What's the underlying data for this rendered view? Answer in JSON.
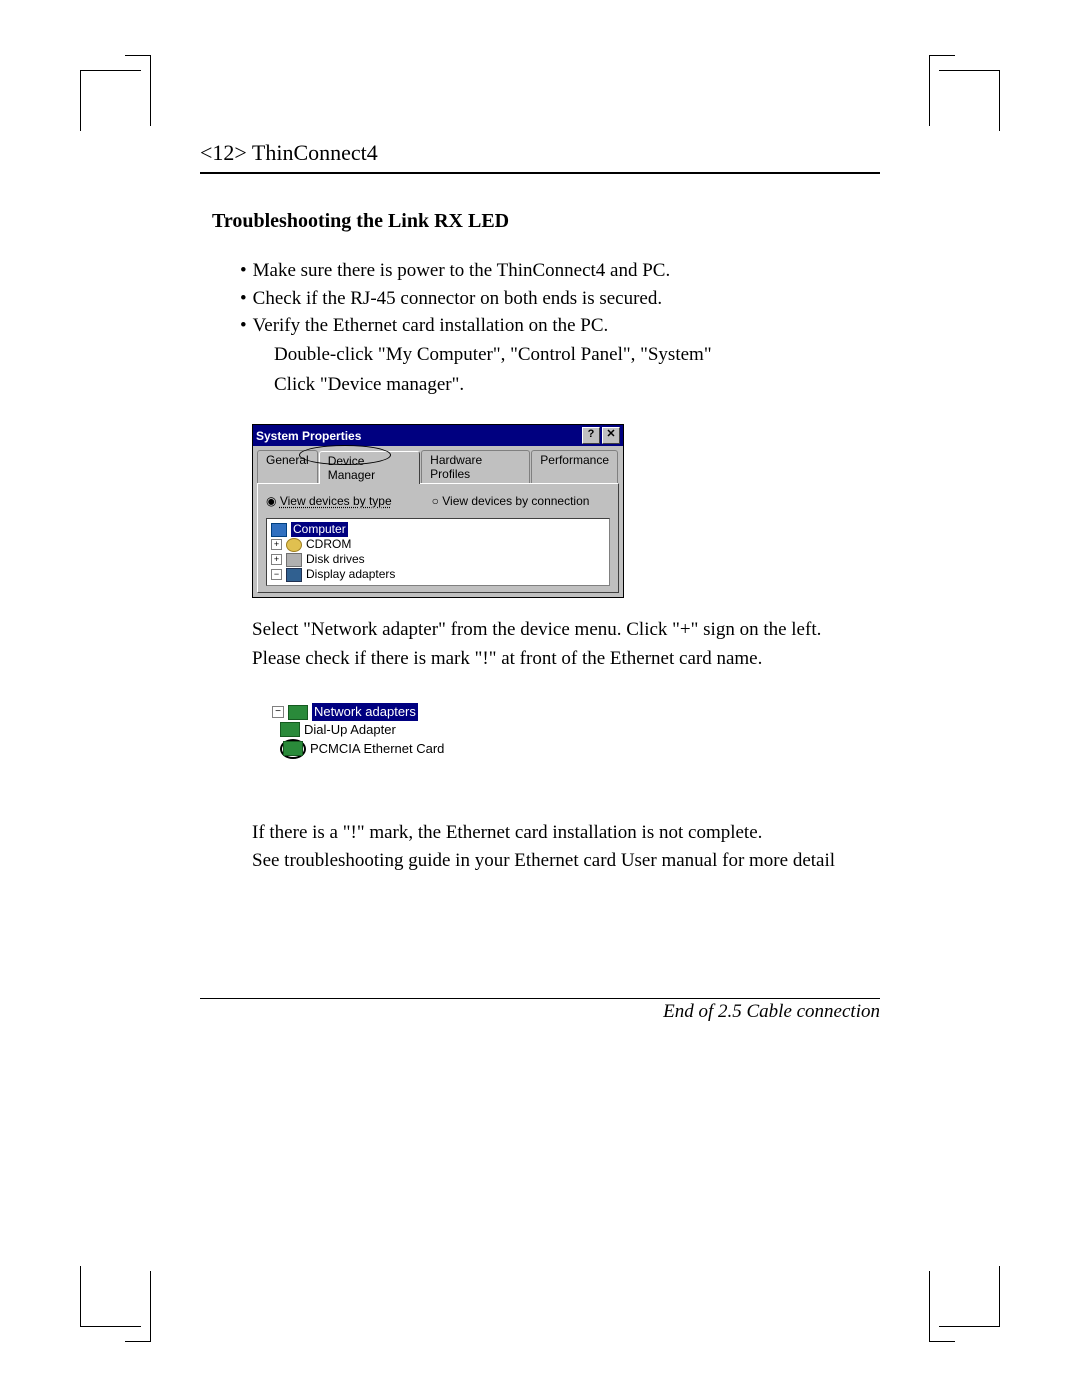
{
  "running_head": "<12> ThinConnect4",
  "section_title": "Troubleshooting the Link RX LED",
  "bullets": {
    "b1": "Make sure there is power to the ThinConnect4 and PC.",
    "b2": "Check if the RJ-45 connector on both ends is secured.",
    "b3": "Verify the Ethernet card installation on the PC."
  },
  "sub_lines": {
    "s1": "Double-click \"My Computer\", \"Control Panel\", \"System\"",
    "s2": "Click \"Device manager\"."
  },
  "sysprop": {
    "title": "System Properties",
    "help": "?",
    "close": "✕",
    "tabs": {
      "general": "General",
      "device_manager": "Device Manager",
      "hardware_profiles": "Hardware Profiles",
      "performance": "Performance"
    },
    "radio_type": "View devices by type",
    "radio_conn": "View devices by connection",
    "tree": {
      "computer": "Computer",
      "cdrom": "CDROM",
      "disk": "Disk drives",
      "display": "Display adapters"
    }
  },
  "mid_para": {
    "p1": "Select \"Network adapter\" from the device menu. Click \"+\" sign on the left.",
    "p2": "Please check if there is mark \"!\" at front of the Ethernet card name."
  },
  "nettree": {
    "root": "Network adapters",
    "dialup": "Dial-Up Adapter",
    "pcmcia": "PCMCIA Ethernet Card"
  },
  "bottom_para": {
    "p1": "If there is a \"!\" mark, the Ethernet card installation is not complete.",
    "p2": "See troubleshooting guide in your Ethernet card User manual for more detail"
  },
  "footer": "End of 2.5 Cable connection"
}
